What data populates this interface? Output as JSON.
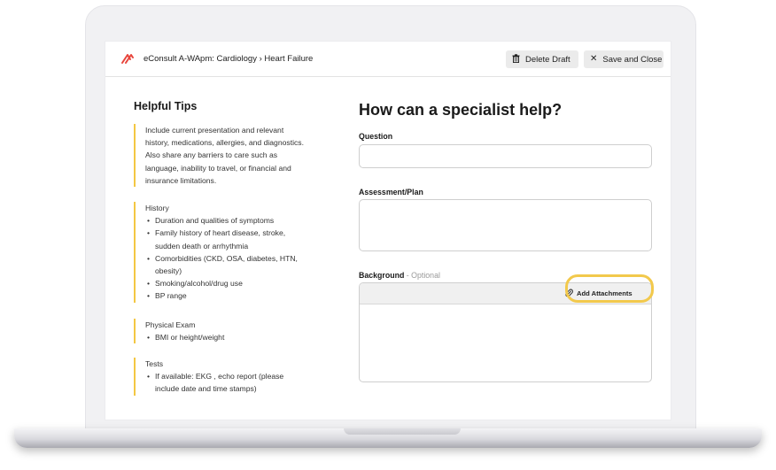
{
  "header": {
    "breadcrumb": "eConsult A-WApm: Cardiology › Heart Failure",
    "delete_label": "Delete Draft",
    "save_label": "Save and Close"
  },
  "tips": {
    "title": "Helpful Tips",
    "intro": "Include current presentation and relevant history, medications, allergies, and diagnostics. Also share any barriers to care such as language, inability to travel, or financial and insurance limitations.",
    "sections": [
      {
        "heading": "History",
        "items": [
          "Duration and qualities of symptoms",
          "Family history of heart disease, stroke, sudden death or arrhythmia",
          "Comorbidities (CKD, OSA, diabetes, HTN, obesity)",
          "Smoking/alcohol/drug use",
          "BP range"
        ]
      },
      {
        "heading": "Physical Exam",
        "items": [
          "BMI or height/weight"
        ]
      },
      {
        "heading": "Tests",
        "items": [
          "If available: EKG , echo report (please include date and time stamps)"
        ]
      }
    ]
  },
  "form": {
    "title": "How can a specialist help?",
    "question_label": "Question",
    "question_value": "",
    "assessment_label": "Assessment/Plan",
    "assessment_value": "",
    "background_label": "Background",
    "background_optional": " - Optional",
    "background_value": "",
    "attach_label": "Add Attachments"
  },
  "colors": {
    "accent_yellow": "#f3c743",
    "logo_red": "#e8453c",
    "button_bg": "#ebebeb"
  },
  "icons": {
    "logo": "brand-logo-icon",
    "delete": "trash-icon",
    "close": "close-icon",
    "attach": "paperclip-icon"
  }
}
